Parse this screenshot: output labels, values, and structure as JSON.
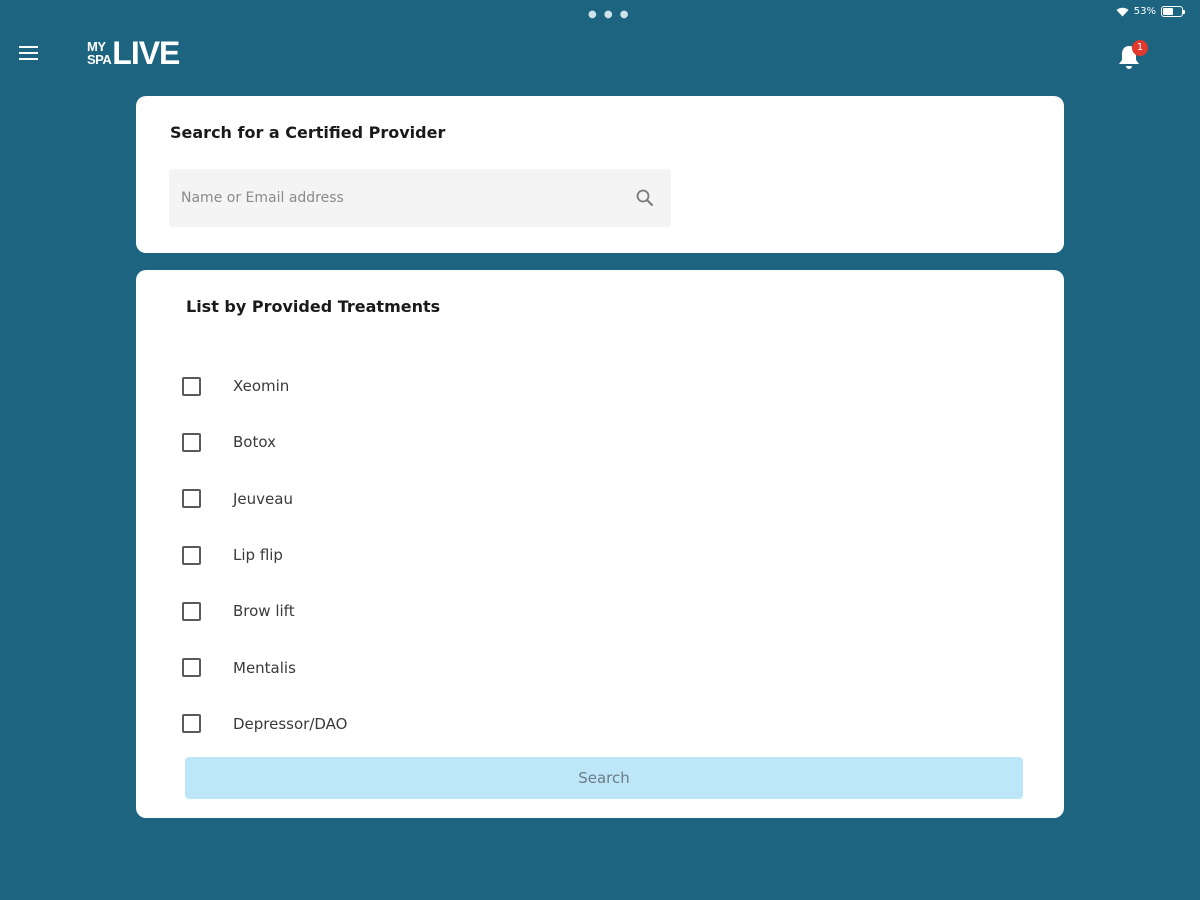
{
  "status_bar": {
    "battery_text": "53%",
    "battery_level": 0.53
  },
  "header": {
    "logo_my": "MY",
    "logo_spa": "SPA",
    "logo_live": "LIVE",
    "notification_count": "1"
  },
  "search_card": {
    "title": "Search for a Certified Provider",
    "placeholder": "Name or Email address",
    "value": ""
  },
  "treatments_card": {
    "title": "List by Provided Treatments",
    "items": [
      {
        "label": "Xeomin",
        "checked": false
      },
      {
        "label": "Botox",
        "checked": false
      },
      {
        "label": "Jeuveau",
        "checked": false
      },
      {
        "label": "Lip flip",
        "checked": false
      },
      {
        "label": "Brow lift",
        "checked": false
      },
      {
        "label": "Mentalis",
        "checked": false
      },
      {
        "label": "Depressor/DAO",
        "checked": false
      }
    ],
    "button_label": "Search"
  },
  "colors": {
    "background": "#1c6480",
    "card": "#ffffff",
    "button": "#bde6f8",
    "badge": "#e03a2f"
  }
}
